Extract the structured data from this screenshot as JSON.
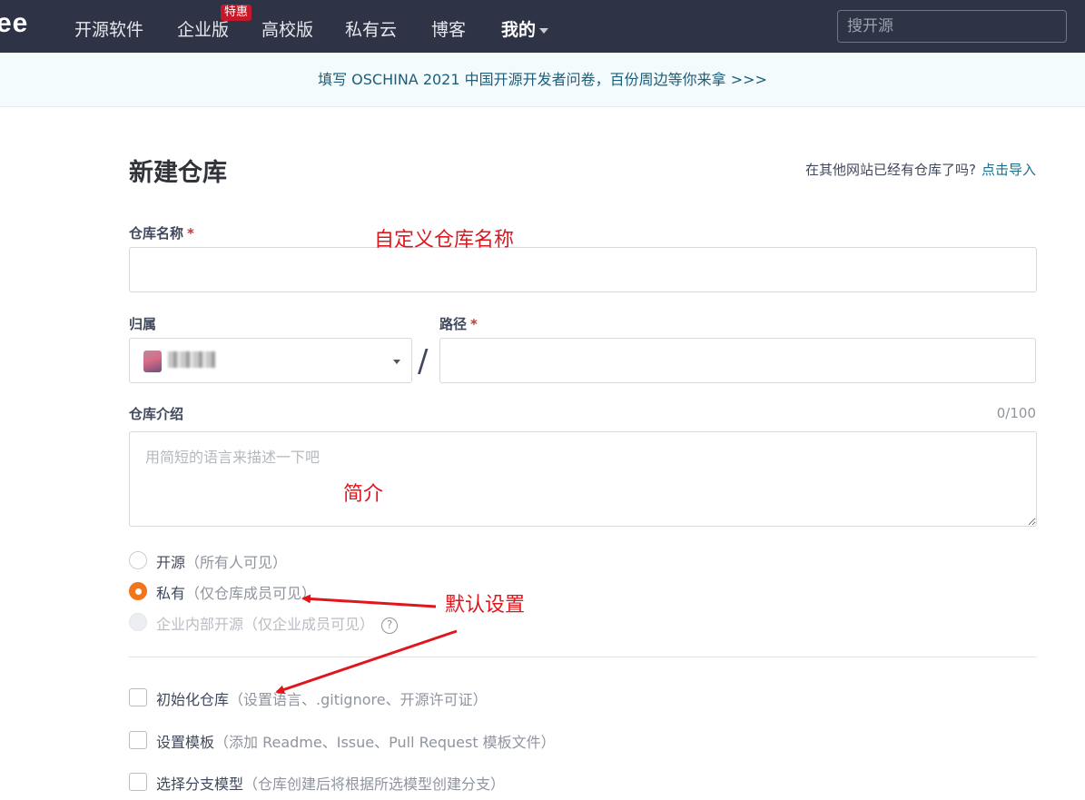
{
  "nav": {
    "logo": "ee",
    "items": [
      {
        "label": "开源软件"
      },
      {
        "label": "企业版",
        "badge": "特惠"
      },
      {
        "label": "高校版"
      },
      {
        "label": "私有云"
      },
      {
        "label": "博客"
      },
      {
        "label": "我的"
      }
    ],
    "search_placeholder": "搜开源"
  },
  "banner": {
    "text": "填写 OSCHINA 2021 中国开源开发者问卷，百份周边等你来拿 >>>"
  },
  "form": {
    "title": "新建仓库",
    "import_prompt": "在其他网站已经有仓库了吗?",
    "import_link": "点击导入",
    "repo_name": {
      "label": "仓库名称",
      "required_mark": "*",
      "value": ""
    },
    "owner": {
      "label": "归属"
    },
    "path": {
      "label": "路径",
      "required_mark": "*",
      "value": "",
      "separator": "/"
    },
    "description": {
      "label": "仓库介绍",
      "counter": "0/100",
      "placeholder": "用简短的语言来描述一下吧"
    },
    "visibility": [
      {
        "label": "开源",
        "hint": "（所有人可见）",
        "state": "unchecked"
      },
      {
        "label": "私有",
        "hint": "（仅仓库成员可见）",
        "state": "checked"
      },
      {
        "label": "企业内部开源",
        "hint": "（仅企业成员可见）",
        "state": "disabled"
      }
    ],
    "help_glyph": "?",
    "options": [
      {
        "label": "初始化仓库",
        "hint": "（设置语言、.gitignore、开源许可证）"
      },
      {
        "label": "设置模板",
        "hint": "（添加 Readme、Issue、Pull Request 模板文件）"
      },
      {
        "label": "选择分支模型",
        "hint": "（仓库创建后将根据所选模型创建分支）"
      }
    ]
  },
  "annotations": {
    "name": "自定义仓库名称",
    "intro": "简介",
    "default": "默认设置"
  },
  "colors": {
    "accent": "#f2751c",
    "annotation": "#e0161d",
    "link": "#1c6e8c",
    "nav_bg": "#2e3445"
  }
}
